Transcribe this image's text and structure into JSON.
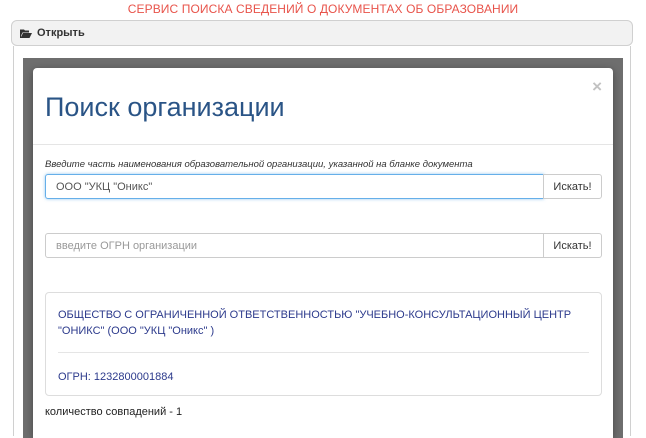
{
  "header": {
    "service_title": "СЕРВИС ПОИСКА СВЕДЕНИЙ О ДОКУМЕНТАХ ОБ ОБРАЗОВАНИИ"
  },
  "open_bar": {
    "icon": "folder-open-icon",
    "label": "Открыть"
  },
  "modal": {
    "title": "Поиск организации",
    "close_symbol": "×",
    "name_search": {
      "hint": "Введите часть наименования образовательной организации, указанной на бланке документа",
      "value": "ООО \"УКЦ \"Оникс\"",
      "button_label": "Искать!"
    },
    "ogrn_search": {
      "placeholder": "введите ОГРН организации",
      "value": "",
      "button_label": "Искать!"
    },
    "results": [
      {
        "name": "ОБЩЕСТВО С ОГРАНИЧЕННОЙ ОТВЕТСТВЕННОСТЬЮ \"УЧЕБНО-КОНСУЛЬТАЦИОННЫЙ ЦЕНТР \"ОНИКС\" (ООО \"УКЦ \"Оникс\" )",
        "ogrn": "ОГРН: 1232800001884"
      }
    ],
    "match_count": "количество совпадений - 1"
  },
  "colors": {
    "service_title": "#e8534a",
    "modal_title": "#2a5486",
    "result_link": "#2c3a8c",
    "backdrop": "#6e6e6e",
    "focus_border": "#66afe9"
  }
}
